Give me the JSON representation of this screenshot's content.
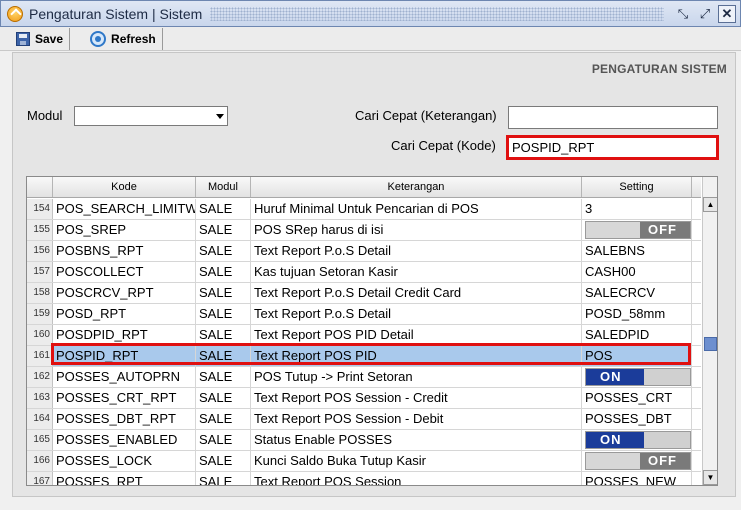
{
  "window": {
    "title": "Pengaturan Sistem | Sistem",
    "close_glyph": "✕",
    "restore_glyph": "⤡",
    "maximize_glyph": "⤢"
  },
  "toolbar": {
    "save_label": "Save",
    "refresh_label": "Refresh"
  },
  "panel": {
    "title": "PENGATURAN SISTEM"
  },
  "filters": {
    "modul_label": "Modul",
    "modul_value": "",
    "cari_keterangan_label": "Cari Cepat (Keterangan)",
    "cari_keterangan_value": "",
    "cari_kode_label": "Cari Cepat (Kode)",
    "cari_kode_value": "POSPID_RPT"
  },
  "grid": {
    "columns": [
      "Kode",
      "Modul",
      "Keterangan",
      "Setting"
    ],
    "selected_row_number": "161",
    "rows": [
      {
        "no": "154",
        "kode": "POS_SEARCH_LIMITW",
        "modul": "SALE",
        "keterangan": "Huruf Minimal Untuk Pencarian di POS",
        "setting": "3",
        "type": "text"
      },
      {
        "no": "155",
        "kode": "POS_SREP",
        "modul": "SALE",
        "keterangan": "POS SRep harus di isi",
        "setting": "OFF",
        "type": "toggle-off"
      },
      {
        "no": "156",
        "kode": "POSBNS_RPT",
        "modul": "SALE",
        "keterangan": "Text Report P.o.S Detail",
        "setting": "SALEBNS",
        "type": "text"
      },
      {
        "no": "157",
        "kode": "POSCOLLECT",
        "modul": "SALE",
        "keterangan": "Kas tujuan Setoran Kasir",
        "setting": "CASH00",
        "type": "text"
      },
      {
        "no": "158",
        "kode": "POSCRCV_RPT",
        "modul": "SALE",
        "keterangan": "Text Report P.o.S Detail Credit Card",
        "setting": "SALECRCV",
        "type": "text"
      },
      {
        "no": "159",
        "kode": "POSD_RPT",
        "modul": "SALE",
        "keterangan": "Text Report P.o.S Detail",
        "setting": "POSD_58mm",
        "type": "text"
      },
      {
        "no": "160",
        "kode": "POSDPID_RPT",
        "modul": "SALE",
        "keterangan": "Text Report POS PID Detail",
        "setting": "SALEDPID",
        "type": "text"
      },
      {
        "no": "161",
        "kode": "POSPID_RPT",
        "modul": "SALE",
        "keterangan": "Text Report POS PID",
        "setting": "POS",
        "type": "text"
      },
      {
        "no": "162",
        "kode": "POSSES_AUTOPRN",
        "modul": "SALE",
        "keterangan": "POS Tutup -> Print Setoran",
        "setting": "ON",
        "type": "toggle-on"
      },
      {
        "no": "163",
        "kode": "POSSES_CRT_RPT",
        "modul": "SALE",
        "keterangan": "Text Report POS Session - Credit",
        "setting": "POSSES_CRT",
        "type": "text"
      },
      {
        "no": "164",
        "kode": "POSSES_DBT_RPT",
        "modul": "SALE",
        "keterangan": "Text Report POS Session - Debit",
        "setting": "POSSES_DBT",
        "type": "text"
      },
      {
        "no": "165",
        "kode": "POSSES_ENABLED",
        "modul": "SALE",
        "keterangan": "Status Enable POSSES",
        "setting": "ON",
        "type": "toggle-on"
      },
      {
        "no": "166",
        "kode": "POSSES_LOCK",
        "modul": "SALE",
        "keterangan": "Kunci Saldo Buka Tutup Kasir",
        "setting": "OFF",
        "type": "toggle-off"
      },
      {
        "no": "167",
        "kode": "POSSES_RPT",
        "modul": "SALE",
        "keterangan": "Text Report POS Session",
        "setting": "POSSES_NEW",
        "type": "text"
      }
    ]
  },
  "colors": {
    "highlight_border": "#e01010",
    "selected_row": "#a9c9ec",
    "toggle_on": "#1b3c9a"
  }
}
